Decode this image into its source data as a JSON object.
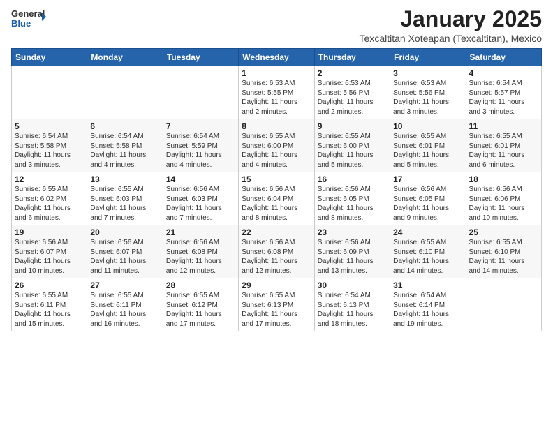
{
  "header": {
    "logo_general": "General",
    "logo_blue": "Blue",
    "month_title": "January 2025",
    "location": "Texcaltitan Xoteapan (Texcaltitan), Mexico"
  },
  "weekdays": [
    "Sunday",
    "Monday",
    "Tuesday",
    "Wednesday",
    "Thursday",
    "Friday",
    "Saturday"
  ],
  "weeks": [
    [
      {
        "day": "",
        "info": ""
      },
      {
        "day": "",
        "info": ""
      },
      {
        "day": "",
        "info": ""
      },
      {
        "day": "1",
        "info": "Sunrise: 6:53 AM\nSunset: 5:55 PM\nDaylight: 11 hours\nand 2 minutes."
      },
      {
        "day": "2",
        "info": "Sunrise: 6:53 AM\nSunset: 5:56 PM\nDaylight: 11 hours\nand 2 minutes."
      },
      {
        "day": "3",
        "info": "Sunrise: 6:53 AM\nSunset: 5:56 PM\nDaylight: 11 hours\nand 3 minutes."
      },
      {
        "day": "4",
        "info": "Sunrise: 6:54 AM\nSunset: 5:57 PM\nDaylight: 11 hours\nand 3 minutes."
      }
    ],
    [
      {
        "day": "5",
        "info": "Sunrise: 6:54 AM\nSunset: 5:58 PM\nDaylight: 11 hours\nand 3 minutes."
      },
      {
        "day": "6",
        "info": "Sunrise: 6:54 AM\nSunset: 5:58 PM\nDaylight: 11 hours\nand 4 minutes."
      },
      {
        "day": "7",
        "info": "Sunrise: 6:54 AM\nSunset: 5:59 PM\nDaylight: 11 hours\nand 4 minutes."
      },
      {
        "day": "8",
        "info": "Sunrise: 6:55 AM\nSunset: 6:00 PM\nDaylight: 11 hours\nand 4 minutes."
      },
      {
        "day": "9",
        "info": "Sunrise: 6:55 AM\nSunset: 6:00 PM\nDaylight: 11 hours\nand 5 minutes."
      },
      {
        "day": "10",
        "info": "Sunrise: 6:55 AM\nSunset: 6:01 PM\nDaylight: 11 hours\nand 5 minutes."
      },
      {
        "day": "11",
        "info": "Sunrise: 6:55 AM\nSunset: 6:01 PM\nDaylight: 11 hours\nand 6 minutes."
      }
    ],
    [
      {
        "day": "12",
        "info": "Sunrise: 6:55 AM\nSunset: 6:02 PM\nDaylight: 11 hours\nand 6 minutes."
      },
      {
        "day": "13",
        "info": "Sunrise: 6:55 AM\nSunset: 6:03 PM\nDaylight: 11 hours\nand 7 minutes."
      },
      {
        "day": "14",
        "info": "Sunrise: 6:56 AM\nSunset: 6:03 PM\nDaylight: 11 hours\nand 7 minutes."
      },
      {
        "day": "15",
        "info": "Sunrise: 6:56 AM\nSunset: 6:04 PM\nDaylight: 11 hours\nand 8 minutes."
      },
      {
        "day": "16",
        "info": "Sunrise: 6:56 AM\nSunset: 6:05 PM\nDaylight: 11 hours\nand 8 minutes."
      },
      {
        "day": "17",
        "info": "Sunrise: 6:56 AM\nSunset: 6:05 PM\nDaylight: 11 hours\nand 9 minutes."
      },
      {
        "day": "18",
        "info": "Sunrise: 6:56 AM\nSunset: 6:06 PM\nDaylight: 11 hours\nand 10 minutes."
      }
    ],
    [
      {
        "day": "19",
        "info": "Sunrise: 6:56 AM\nSunset: 6:07 PM\nDaylight: 11 hours\nand 10 minutes."
      },
      {
        "day": "20",
        "info": "Sunrise: 6:56 AM\nSunset: 6:07 PM\nDaylight: 11 hours\nand 11 minutes."
      },
      {
        "day": "21",
        "info": "Sunrise: 6:56 AM\nSunset: 6:08 PM\nDaylight: 11 hours\nand 12 minutes."
      },
      {
        "day": "22",
        "info": "Sunrise: 6:56 AM\nSunset: 6:08 PM\nDaylight: 11 hours\nand 12 minutes."
      },
      {
        "day": "23",
        "info": "Sunrise: 6:56 AM\nSunset: 6:09 PM\nDaylight: 11 hours\nand 13 minutes."
      },
      {
        "day": "24",
        "info": "Sunrise: 6:55 AM\nSunset: 6:10 PM\nDaylight: 11 hours\nand 14 minutes."
      },
      {
        "day": "25",
        "info": "Sunrise: 6:55 AM\nSunset: 6:10 PM\nDaylight: 11 hours\nand 14 minutes."
      }
    ],
    [
      {
        "day": "26",
        "info": "Sunrise: 6:55 AM\nSunset: 6:11 PM\nDaylight: 11 hours\nand 15 minutes."
      },
      {
        "day": "27",
        "info": "Sunrise: 6:55 AM\nSunset: 6:11 PM\nDaylight: 11 hours\nand 16 minutes."
      },
      {
        "day": "28",
        "info": "Sunrise: 6:55 AM\nSunset: 6:12 PM\nDaylight: 11 hours\nand 17 minutes."
      },
      {
        "day": "29",
        "info": "Sunrise: 6:55 AM\nSunset: 6:13 PM\nDaylight: 11 hours\nand 17 minutes."
      },
      {
        "day": "30",
        "info": "Sunrise: 6:54 AM\nSunset: 6:13 PM\nDaylight: 11 hours\nand 18 minutes."
      },
      {
        "day": "31",
        "info": "Sunrise: 6:54 AM\nSunset: 6:14 PM\nDaylight: 11 hours\nand 19 minutes."
      },
      {
        "day": "",
        "info": ""
      }
    ]
  ]
}
